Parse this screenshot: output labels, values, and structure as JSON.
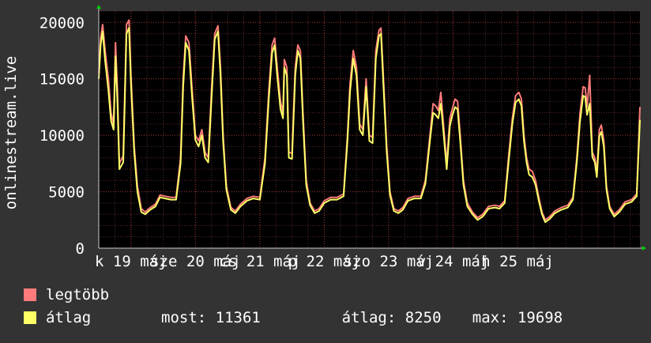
{
  "chart_data": {
    "type": "line",
    "ylabel": "onlinestream.live",
    "ylim": [
      0,
      21000
    ],
    "yticks": [
      0,
      5000,
      10000,
      15000,
      20000
    ],
    "x_tick_labels": [
      "k 19 máj",
      "sze 20 máj",
      "cs 21 máj",
      "p 22 máj",
      "szo 23 máj",
      "v 24 máj",
      "h 25 máj"
    ],
    "grid": true,
    "series": [
      {
        "name": "legtöbb",
        "color": "#ff7b7b",
        "points": [
          [
            0,
            15500
          ],
          [
            0.03,
            18600
          ],
          [
            0.06,
            19800
          ],
          [
            0.1,
            17400
          ],
          [
            0.15,
            15000
          ],
          [
            0.19,
            12000
          ],
          [
            0.23,
            11000
          ],
          [
            0.26,
            18200
          ],
          [
            0.29,
            14000
          ],
          [
            0.32,
            7500
          ],
          [
            0.38,
            8200
          ],
          [
            0.43,
            19800
          ],
          [
            0.47,
            20200
          ],
          [
            0.5,
            15300
          ],
          [
            0.55,
            9000
          ],
          [
            0.6,
            5500
          ],
          [
            0.66,
            3500
          ],
          [
            0.72,
            3200
          ],
          [
            0.8,
            3600
          ],
          [
            0.88,
            3900
          ],
          [
            0.95,
            4700
          ],
          [
            1.03,
            4600
          ],
          [
            1.12,
            4500
          ],
          [
            1.2,
            4500
          ],
          [
            1.27,
            8000
          ],
          [
            1.31,
            15000
          ],
          [
            1.35,
            18800
          ],
          [
            1.4,
            18200
          ],
          [
            1.45,
            14000
          ],
          [
            1.5,
            10000
          ],
          [
            1.55,
            9500
          ],
          [
            1.6,
            10500
          ],
          [
            1.65,
            8500
          ],
          [
            1.7,
            8000
          ],
          [
            1.75,
            14000
          ],
          [
            1.8,
            19000
          ],
          [
            1.85,
            19700
          ],
          [
            1.89,
            16000
          ],
          [
            1.93,
            10000
          ],
          [
            1.98,
            5500
          ],
          [
            2.05,
            3600
          ],
          [
            2.12,
            3300
          ],
          [
            2.2,
            3900
          ],
          [
            2.3,
            4400
          ],
          [
            2.4,
            4600
          ],
          [
            2.5,
            4500
          ],
          [
            2.58,
            8000
          ],
          [
            2.64,
            14000
          ],
          [
            2.69,
            18000
          ],
          [
            2.73,
            18600
          ],
          [
            2.77,
            16000
          ],
          [
            2.82,
            13000
          ],
          [
            2.86,
            12000
          ],
          [
            2.88,
            16700
          ],
          [
            2.92,
            16000
          ],
          [
            2.95,
            8500
          ],
          [
            3.0,
            8400
          ],
          [
            3.05,
            16000
          ],
          [
            3.09,
            18000
          ],
          [
            3.13,
            17500
          ],
          [
            3.17,
            12000
          ],
          [
            3.22,
            6000
          ],
          [
            3.28,
            4000
          ],
          [
            3.35,
            3300
          ],
          [
            3.42,
            3500
          ],
          [
            3.5,
            4200
          ],
          [
            3.6,
            4500
          ],
          [
            3.7,
            4500
          ],
          [
            3.8,
            4800
          ],
          [
            3.86,
            10000
          ],
          [
            3.9,
            14500
          ],
          [
            3.95,
            17500
          ],
          [
            4.0,
            16000
          ],
          [
            4.05,
            11000
          ],
          [
            4.1,
            10500
          ],
          [
            4.15,
            15000
          ],
          [
            4.2,
            10000
          ],
          [
            4.25,
            9800
          ],
          [
            4.3,
            17500
          ],
          [
            4.35,
            19300
          ],
          [
            4.38,
            19500
          ],
          [
            4.42,
            15000
          ],
          [
            4.47,
            9000
          ],
          [
            4.52,
            5000
          ],
          [
            4.58,
            3500
          ],
          [
            4.65,
            3300
          ],
          [
            4.72,
            3600
          ],
          [
            4.8,
            4400
          ],
          [
            4.9,
            4600
          ],
          [
            5.0,
            4600
          ],
          [
            5.07,
            6000
          ],
          [
            5.14,
            10000
          ],
          [
            5.19,
            12800
          ],
          [
            5.23,
            12600
          ],
          [
            5.27,
            12200
          ],
          [
            5.31,
            13800
          ],
          [
            5.35,
            11000
          ],
          [
            5.4,
            7500
          ],
          [
            5.45,
            11500
          ],
          [
            5.49,
            12400
          ],
          [
            5.53,
            13200
          ],
          [
            5.57,
            13000
          ],
          [
            5.61,
            10000
          ],
          [
            5.66,
            6000
          ],
          [
            5.72,
            4000
          ],
          [
            5.8,
            3200
          ],
          [
            5.88,
            2700
          ],
          [
            5.96,
            3000
          ],
          [
            6.05,
            3700
          ],
          [
            6.15,
            3800
          ],
          [
            6.22,
            3700
          ],
          [
            6.3,
            4200
          ],
          [
            6.36,
            8000
          ],
          [
            6.42,
            11500
          ],
          [
            6.47,
            13500
          ],
          [
            6.52,
            13800
          ],
          [
            6.56,
            13200
          ],
          [
            6.6,
            10000
          ],
          [
            6.64,
            8000
          ],
          [
            6.68,
            7000
          ],
          [
            6.73,
            6800
          ],
          [
            6.78,
            6000
          ],
          [
            6.83,
            4500
          ],
          [
            6.88,
            3200
          ],
          [
            6.93,
            2500
          ],
          [
            7.0,
            2800
          ],
          [
            7.08,
            3300
          ],
          [
            7.18,
            3600
          ],
          [
            7.28,
            3800
          ],
          [
            7.36,
            4500
          ],
          [
            7.42,
            8000
          ],
          [
            7.47,
            12000
          ],
          [
            7.52,
            14300
          ],
          [
            7.55,
            14200
          ],
          [
            7.58,
            12500
          ],
          [
            7.62,
            15300
          ],
          [
            7.66,
            8500
          ],
          [
            7.7,
            8000
          ],
          [
            7.73,
            6700
          ],
          [
            7.77,
            10500
          ],
          [
            7.8,
            10900
          ],
          [
            7.84,
            9500
          ],
          [
            7.88,
            5500
          ],
          [
            7.93,
            3700
          ],
          [
            8.0,
            3000
          ],
          [
            8.08,
            3400
          ],
          [
            8.17,
            4100
          ],
          [
            8.27,
            4300
          ],
          [
            8.35,
            4800
          ],
          [
            8.4,
            12500
          ]
        ]
      },
      {
        "name": "átlag",
        "color": "#ffff66",
        "points": [
          [
            0,
            15000
          ],
          [
            0.03,
            18000
          ],
          [
            0.06,
            19200
          ],
          [
            0.1,
            16500
          ],
          [
            0.15,
            14000
          ],
          [
            0.19,
            11300
          ],
          [
            0.23,
            10500
          ],
          [
            0.26,
            17000
          ],
          [
            0.29,
            13000
          ],
          [
            0.32,
            7000
          ],
          [
            0.38,
            7600
          ],
          [
            0.43,
            19000
          ],
          [
            0.47,
            19500
          ],
          [
            0.5,
            14500
          ],
          [
            0.55,
            8500
          ],
          [
            0.6,
            5000
          ],
          [
            0.66,
            3200
          ],
          [
            0.72,
            3000
          ],
          [
            0.8,
            3400
          ],
          [
            0.88,
            3700
          ],
          [
            0.95,
            4500
          ],
          [
            1.03,
            4400
          ],
          [
            1.12,
            4300
          ],
          [
            1.2,
            4300
          ],
          [
            1.27,
            7500
          ],
          [
            1.31,
            14200
          ],
          [
            1.35,
            18200
          ],
          [
            1.4,
            17500
          ],
          [
            1.45,
            13300
          ],
          [
            1.5,
            9600
          ],
          [
            1.55,
            9000
          ],
          [
            1.6,
            10000
          ],
          [
            1.65,
            8000
          ],
          [
            1.7,
            7600
          ],
          [
            1.75,
            13200
          ],
          [
            1.8,
            18500
          ],
          [
            1.85,
            19200
          ],
          [
            1.89,
            15300
          ],
          [
            1.93,
            9500
          ],
          [
            1.98,
            5200
          ],
          [
            2.05,
            3400
          ],
          [
            2.12,
            3100
          ],
          [
            2.2,
            3700
          ],
          [
            2.3,
            4200
          ],
          [
            2.4,
            4400
          ],
          [
            2.5,
            4300
          ],
          [
            2.58,
            7500
          ],
          [
            2.64,
            13300
          ],
          [
            2.69,
            17300
          ],
          [
            2.73,
            18000
          ],
          [
            2.77,
            15300
          ],
          [
            2.82,
            12300
          ],
          [
            2.86,
            11500
          ],
          [
            2.88,
            16000
          ],
          [
            2.92,
            15300
          ],
          [
            2.95,
            8000
          ],
          [
            3.0,
            7900
          ],
          [
            3.05,
            15300
          ],
          [
            3.09,
            17500
          ],
          [
            3.13,
            16800
          ],
          [
            3.17,
            11300
          ],
          [
            3.22,
            5600
          ],
          [
            3.28,
            3800
          ],
          [
            3.35,
            3100
          ],
          [
            3.42,
            3300
          ],
          [
            3.5,
            4000
          ],
          [
            3.6,
            4300
          ],
          [
            3.7,
            4300
          ],
          [
            3.8,
            4600
          ],
          [
            3.86,
            9500
          ],
          [
            3.9,
            13800
          ],
          [
            3.95,
            16800
          ],
          [
            4.0,
            15300
          ],
          [
            4.05,
            10500
          ],
          [
            4.1,
            10000
          ],
          [
            4.15,
            14300
          ],
          [
            4.2,
            9500
          ],
          [
            4.25,
            9300
          ],
          [
            4.3,
            16800
          ],
          [
            4.35,
            18800
          ],
          [
            4.38,
            19000
          ],
          [
            4.42,
            14300
          ],
          [
            4.47,
            8500
          ],
          [
            4.52,
            4700
          ],
          [
            4.58,
            3300
          ],
          [
            4.65,
            3100
          ],
          [
            4.72,
            3400
          ],
          [
            4.8,
            4200
          ],
          [
            4.9,
            4400
          ],
          [
            5.0,
            4400
          ],
          [
            5.07,
            5700
          ],
          [
            5.14,
            9500
          ],
          [
            5.19,
            12000
          ],
          [
            5.23,
            11800
          ],
          [
            5.27,
            11500
          ],
          [
            5.31,
            12800
          ],
          [
            5.35,
            10300
          ],
          [
            5.4,
            7000
          ],
          [
            5.45,
            10800
          ],
          [
            5.49,
            11800
          ],
          [
            5.53,
            12500
          ],
          [
            5.57,
            12300
          ],
          [
            5.61,
            9500
          ],
          [
            5.66,
            5600
          ],
          [
            5.72,
            3700
          ],
          [
            5.8,
            3000
          ],
          [
            5.88,
            2500
          ],
          [
            5.96,
            2800
          ],
          [
            6.05,
            3500
          ],
          [
            6.15,
            3600
          ],
          [
            6.22,
            3500
          ],
          [
            6.3,
            4000
          ],
          [
            6.36,
            7500
          ],
          [
            6.42,
            11000
          ],
          [
            6.47,
            12900
          ],
          [
            6.52,
            13200
          ],
          [
            6.56,
            12600
          ],
          [
            6.6,
            9500
          ],
          [
            6.64,
            7600
          ],
          [
            6.68,
            6500
          ],
          [
            6.73,
            6300
          ],
          [
            6.78,
            5600
          ],
          [
            6.83,
            4200
          ],
          [
            6.88,
            3000
          ],
          [
            6.93,
            2300
          ],
          [
            7.0,
            2600
          ],
          [
            7.08,
            3100
          ],
          [
            7.18,
            3400
          ],
          [
            7.28,
            3600
          ],
          [
            7.36,
            4300
          ],
          [
            7.42,
            7600
          ],
          [
            7.47,
            11300
          ],
          [
            7.52,
            13500
          ],
          [
            7.55,
            13400
          ],
          [
            7.58,
            11800
          ],
          [
            7.62,
            12800
          ],
          [
            7.66,
            8100
          ],
          [
            7.7,
            7600
          ],
          [
            7.73,
            6300
          ],
          [
            7.77,
            9900
          ],
          [
            7.8,
            10300
          ],
          [
            7.84,
            9000
          ],
          [
            7.88,
            5200
          ],
          [
            7.93,
            3500
          ],
          [
            8.0,
            2800
          ],
          [
            8.08,
            3200
          ],
          [
            8.17,
            3900
          ],
          [
            8.27,
            4100
          ],
          [
            8.35,
            4600
          ],
          [
            8.4,
            11361
          ]
        ]
      }
    ],
    "x_range": [
      0,
      8.4
    ],
    "stats": {
      "most_label": "most:",
      "most_value": "11361",
      "atlag_label": "átlag:",
      "atlag_value": "8250",
      "max_label": "max:",
      "max_value": "19698"
    }
  }
}
